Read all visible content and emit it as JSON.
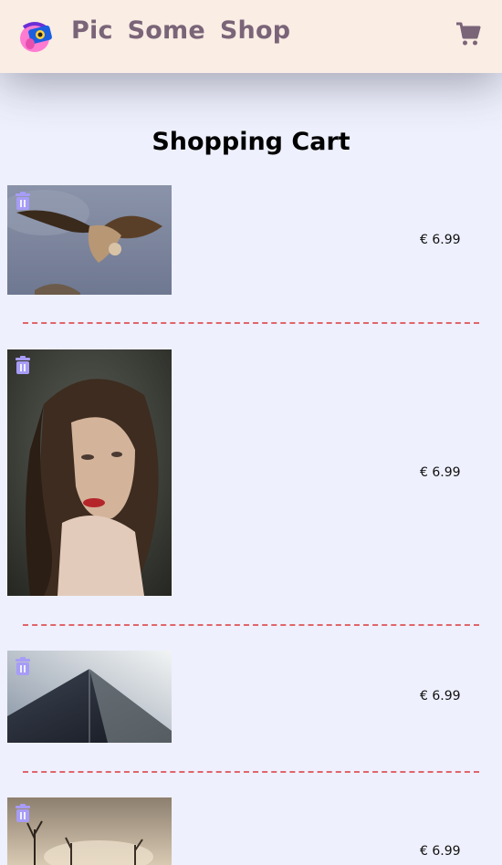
{
  "header": {
    "brand_words": [
      "Pic",
      "Some",
      "Shop"
    ]
  },
  "page": {
    "title": "Shopping Cart"
  },
  "cart": {
    "items": [
      {
        "price": "€ 6.99"
      },
      {
        "price": "€ 6.99"
      },
      {
        "price": "€ 6.99"
      },
      {
        "price": "€ 6.99"
      }
    ]
  },
  "colors": {
    "header_bg": "#f9ede4",
    "page_bg": "#eef0fd",
    "brand_text": "#7a6478",
    "trash_icon": "#a79cf7",
    "divider": "#e0656a"
  }
}
